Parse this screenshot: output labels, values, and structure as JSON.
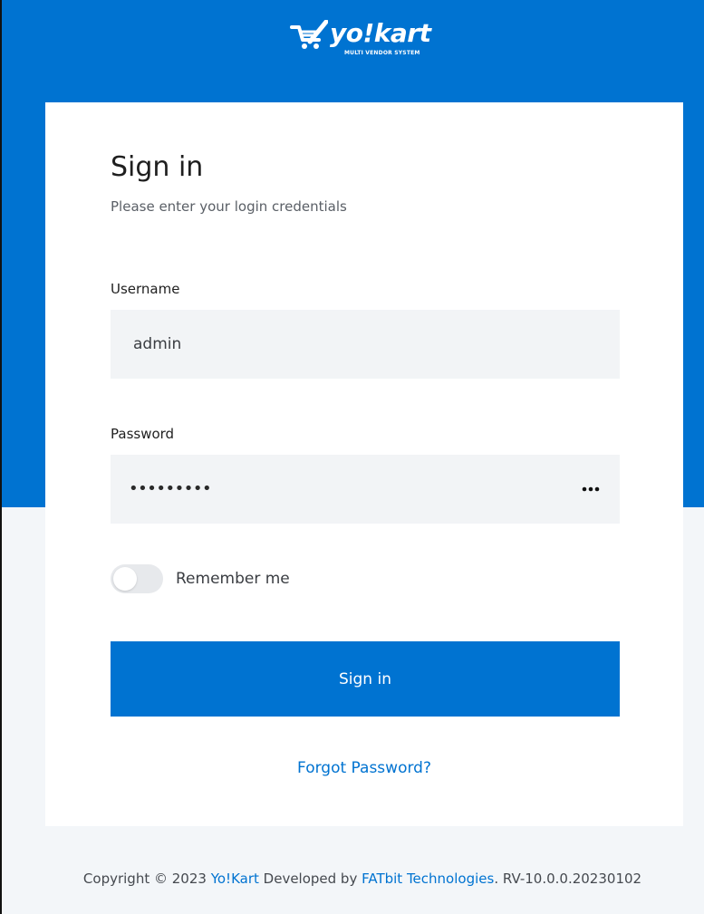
{
  "brand": {
    "name": "yo!kart",
    "tagline": "MULTI VENDOR SYSTEM"
  },
  "colors": {
    "primary": "#0073d1",
    "page_bg": "#f3f6f9",
    "input_bg": "#f2f4f6"
  },
  "form": {
    "title": "Sign in",
    "subtitle": "Please enter your login credentials",
    "username_label": "Username",
    "username_value": "admin",
    "password_label": "Password",
    "password_mask": "•••••••••",
    "password_toggle_icon": "more-horizontal-icon",
    "remember_label": "Remember me",
    "remember_checked": false,
    "submit_label": "Sign in",
    "forgot_label": "Forgot Password?"
  },
  "footer": {
    "prefix": "Copyright © 2023 ",
    "brand_link": "Yo!Kart",
    "middle": " Developed by ",
    "company_link": "FATbit Technologies",
    "suffix": ". RV-10.0.0.20230102"
  }
}
